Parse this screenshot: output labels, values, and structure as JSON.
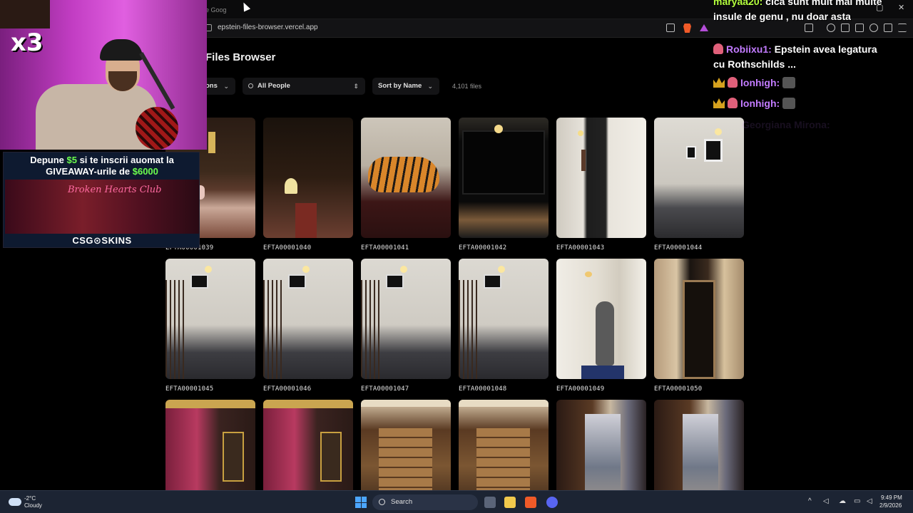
{
  "browser": {
    "tab_title": "re Goog",
    "url": "epstein-files-browser.vercel.app"
  },
  "app": {
    "title": "Files Browser",
    "filters": {
      "collection": "ons",
      "people": "All People",
      "sort": "Sort by Name"
    },
    "file_count": "4,101 files",
    "files": [
      {
        "id": "EFTA00001039",
        "label": "EFTA00001039",
        "scene": "lounge"
      },
      {
        "id": "EFTA00001040",
        "label": "EFTA00001040",
        "scene": "hall"
      },
      {
        "id": "EFTA00001041",
        "label": "EFTA00001041",
        "scene": "tiger"
      },
      {
        "id": "EFTA00001042",
        "label": "EFTA00001042",
        "scene": "tv"
      },
      {
        "id": "EFTA00001043",
        "label": "EFTA00001043",
        "scene": "door"
      },
      {
        "id": "EFTA00001044",
        "label": "EFTA00001044",
        "scene": "stairs"
      },
      {
        "id": "EFTA00001045",
        "label": "EFTA00001045",
        "scene": "stair2"
      },
      {
        "id": "EFTA00001046",
        "label": "EFTA00001046",
        "scene": "stair2"
      },
      {
        "id": "EFTA00001047",
        "label": "EFTA00001047",
        "scene": "stair2"
      },
      {
        "id": "EFTA00001048",
        "label": "EFTA00001048",
        "scene": "stair2"
      },
      {
        "id": "EFTA00001049",
        "label": "EFTA00001049",
        "scene": "statue"
      },
      {
        "id": "EFTA00001050",
        "label": "EFTA00001050",
        "scene": "corr"
      },
      {
        "id": "row3-1",
        "label": "",
        "scene": "pink"
      },
      {
        "id": "row3-2",
        "label": "",
        "scene": "pink"
      },
      {
        "id": "row3-3",
        "label": "",
        "scene": "wood"
      },
      {
        "id": "row3-4",
        "label": "",
        "scene": "wood"
      },
      {
        "id": "row3-5",
        "label": "",
        "scene": "mural"
      },
      {
        "id": "row3-6",
        "label": "",
        "scene": "mural"
      }
    ]
  },
  "stream": {
    "multiplier": "x3",
    "promo": {
      "line1_a": "Depune ",
      "line1_amount": "$5",
      "line1_b": " si te inscrii auomat la",
      "line2_a": "GIVEAWAY-urile de ",
      "line2_amount": "$6000",
      "neon_sign": "Broken Hearts Club",
      "brand": "CSG⊙SKINS"
    },
    "chat": [
      {
        "user": "maryaa20:",
        "text": " cica sunt mult mai multe insule de genu , nu doar asta",
        "color": "#b4ff3e"
      },
      {
        "user": "Robiixu1:",
        "text": " Epstein avea legatura cu Rothschilds ...",
        "color": "#c27bff"
      },
      {
        "user": "Ionhigh:",
        "text": "",
        "color": "#c27bff"
      },
      {
        "user": "Ionhigh:",
        "text": "",
        "color": "#c27bff"
      },
      {
        "user": "Georgiana Mirona:",
        "text": "",
        "color": "#c27bff"
      }
    ]
  },
  "taskbar": {
    "weather_temp": "-2°C",
    "weather_desc": "Cloudy",
    "search_placeholder": "Search",
    "time": "9:49 PM",
    "date": "2/9/2026"
  }
}
